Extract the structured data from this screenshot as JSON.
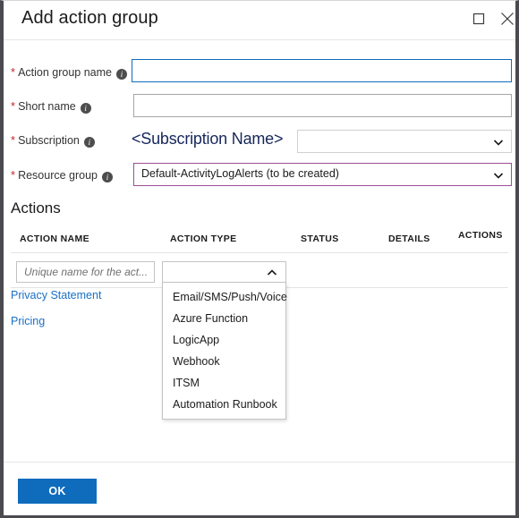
{
  "window": {
    "title": "Add action group",
    "maximize_icon": "maximize-square-icon",
    "close_icon": "close-x-icon"
  },
  "form": {
    "required_marker": "*",
    "info_icon": "info-icon",
    "fields": [
      {
        "label": "Action group name",
        "required": true,
        "value": "",
        "placeholder": "",
        "state": "focused",
        "control": "text"
      },
      {
        "label": "Short name",
        "required": true,
        "value": "",
        "placeholder": "",
        "state": "normal",
        "control": "text"
      },
      {
        "label": "Subscription",
        "required": true,
        "value": "",
        "state": "gray",
        "control": "dropdown",
        "annotation": "<Subscription Name>"
      },
      {
        "label": "Resource group",
        "required": true,
        "value": "Default-ActivityLogAlerts (to be created)",
        "state": "purple",
        "control": "dropdown"
      }
    ]
  },
  "actions": {
    "section_title": "Actions",
    "columns": [
      "ACTION NAME",
      "ACTION TYPE",
      "STATUS",
      "DETAILS",
      "ACTIONS"
    ],
    "row": {
      "name_placeholder": "Unique name for the act...",
      "name_value": "",
      "type_value": "",
      "type_expanded": true,
      "chevron_up_icon": "chevron-up-icon"
    },
    "type_options": [
      "Email/SMS/Push/Voice",
      "Azure Function",
      "LogicApp",
      "Webhook",
      "ITSM",
      "Automation Runbook"
    ]
  },
  "links": [
    {
      "label": "Privacy Statement"
    },
    {
      "label": "Pricing"
    }
  ],
  "footer": {
    "ok_label": "OK"
  },
  "colors": {
    "accent": "#0f6cbd",
    "focus_border": "#0f6cbd",
    "purple_border": "#9a4f96",
    "required_star": "#c6262e",
    "link": "#1a6fc4",
    "annotation": "#16275c",
    "frame": "#4a4a4f"
  }
}
